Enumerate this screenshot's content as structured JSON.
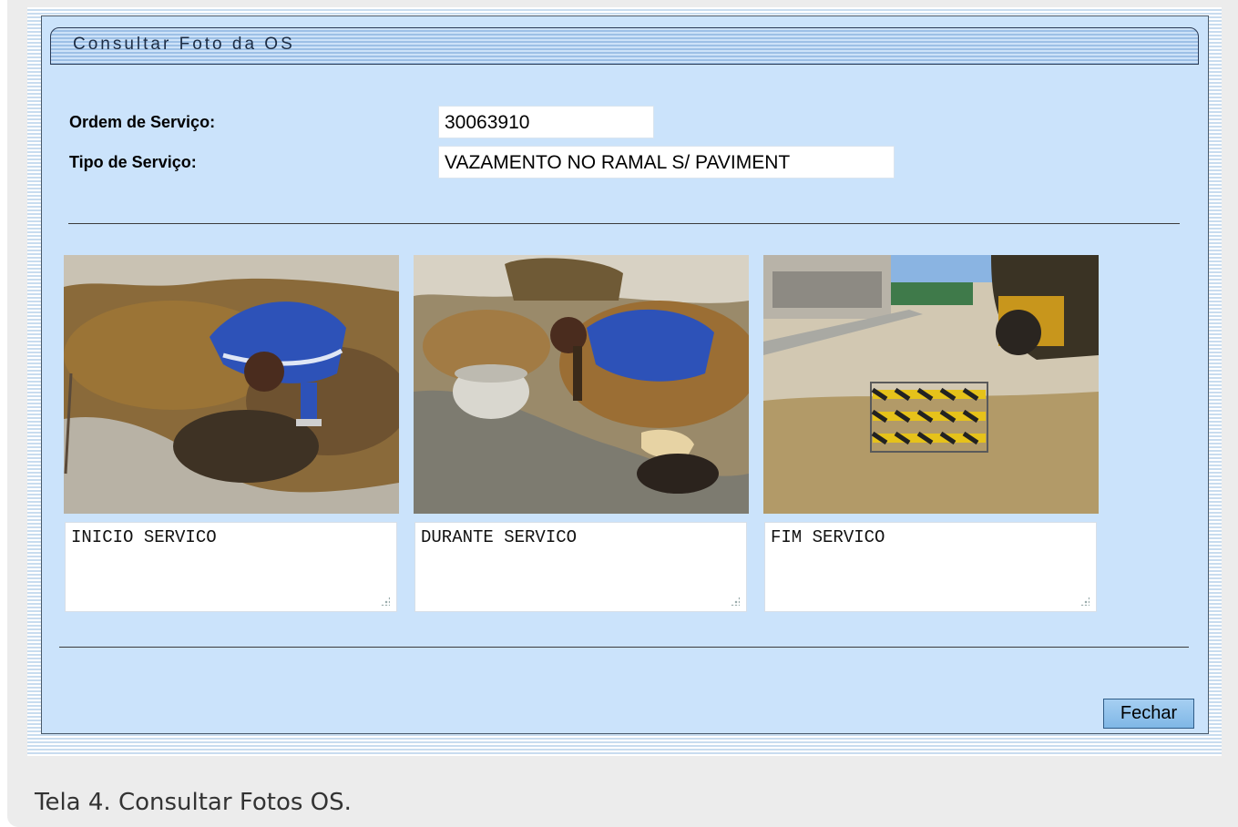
{
  "panel": {
    "title": "Consultar Foto da OS"
  },
  "form": {
    "ordem_label": "Ordem de Serviço:",
    "ordem_value": "30063910",
    "tipo_label": "Tipo de Serviço:",
    "tipo_value": "VAZAMENTO NO RAMAL S/ PAVIMENT"
  },
  "photos": [
    {
      "caption": "INICIO SERVICO"
    },
    {
      "caption": "DURANTE SERVICO"
    },
    {
      "caption": "FIM SERVICO"
    }
  ],
  "buttons": {
    "close_label": "Fechar"
  },
  "figure_caption": "Tela 4. Consultar Fotos OS."
}
